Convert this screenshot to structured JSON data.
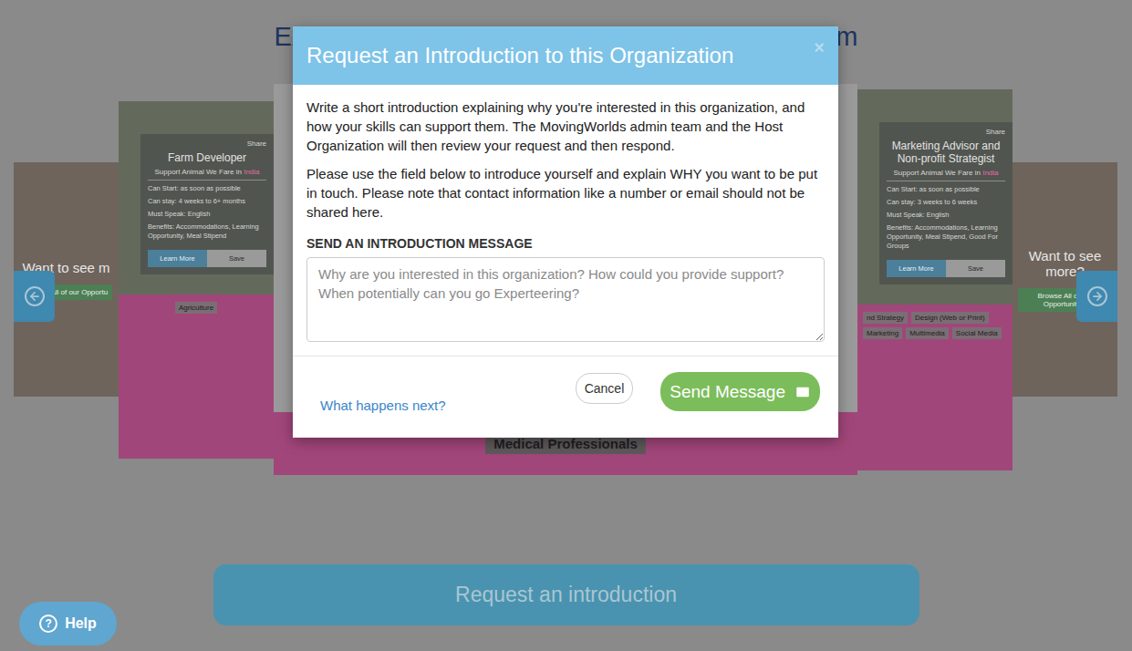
{
  "page": {
    "heading_start": "Ex",
    "heading_end": "m",
    "request_button": "Request an introduction",
    "help_icon": "?",
    "help_button": "Help"
  },
  "carousel": {
    "cards": [
      {
        "kind": "more",
        "title": "Want to see m",
        "button": "Browse All of our Opportu"
      },
      {
        "kind": "opportunity",
        "share": "Share",
        "title": "Farm Developer",
        "organization": "Support Animal We Fare in",
        "country": "India",
        "details": [
          "Can Start: as soon as possible",
          "Can stay: 4 weeks to 6+ months",
          "Must Speak: English",
          "Benefits: Accommodations, Learning Opportunity, Meal Stipend"
        ],
        "buttons": [
          "Learn More",
          "Save"
        ],
        "tags": [
          "Agriculture"
        ]
      },
      {
        "kind": "featured",
        "tags": [
          "Medical Professionals"
        ]
      },
      {
        "kind": "opportunity",
        "share": "Share",
        "title": "Marketing Advisor and Non-profit Strategist",
        "organization": "Support Animal We Fare in",
        "country": "India",
        "details": [
          "Can Start: as soon as possible",
          "Can stay: 3 weeks to 6 weeks",
          "Must Speak: English",
          "Benefits: Accommodations, Learning Opportunity, Meal Stipend, Good For Groups"
        ],
        "buttons": [
          "Learn More",
          "Save"
        ],
        "tags": [
          "nd Strategy",
          "Design (Web or Print)",
          "Marketing",
          "Multimedia",
          "Social Media"
        ]
      },
      {
        "kind": "more",
        "title": "Want to see more?",
        "button": "Browse All of our Opportunities"
      }
    ]
  },
  "modal": {
    "title": "Request an Introduction to this Organization",
    "close": "×",
    "paragraphs": [
      "Write a short introduction explaining why you're interested in this organization, and how your skills can support them. The MovingWorlds admin team and the Host Organization will then review your request and then respond.",
      "Please use the field below to introduce yourself and explain WHY you want to be put in touch. Please note that contact information like a number or email should not be shared here."
    ],
    "label": "SEND AN INTRODUCTION MESSAGE",
    "textarea": {
      "placeholder": "Why are you interested in this organization? How could you provide support? When potentially can you go Experteering?",
      "value": ""
    },
    "link": "What happens next?",
    "buttons": [
      {
        "label": "Cancel",
        "kind": "secondary"
      },
      {
        "label": "Send Message",
        "kind": "primary"
      }
    ]
  }
}
